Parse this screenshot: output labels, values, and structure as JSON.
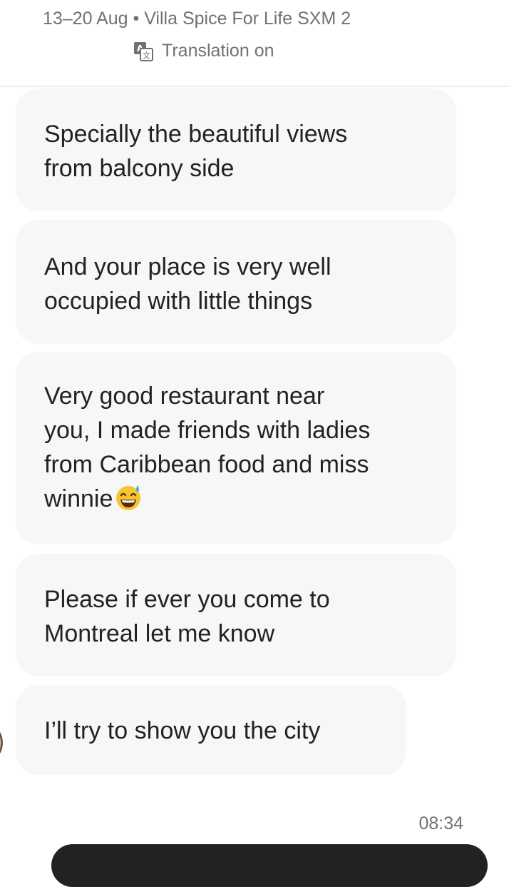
{
  "header": {
    "subtitle": "13–20 Aug • Villa Spice For Life SXM 2",
    "translation_label": "Translation on",
    "translation_icon": "translate-icon"
  },
  "messages": [
    {
      "text": "Specially the beautiful views\nfrom balcony side"
    },
    {
      "text": "And your place is very well\noccupied with little things"
    },
    {
      "text": "Very good restaurant near\nyou, I made friends with ladies\nfrom Caribbean food and miss\nwinnie",
      "emoji": "grinning-face-with-sweat-emoji"
    },
    {
      "text": "Please if ever you come to\nMontreal let me know"
    },
    {
      "text": "I’ll try to show you the city"
    }
  ],
  "timestamp": "08:34",
  "colors": {
    "bubble_bg": "#f7f7f7",
    "text": "#222222",
    "muted": "#717171",
    "bottom_bar": "#222222"
  }
}
